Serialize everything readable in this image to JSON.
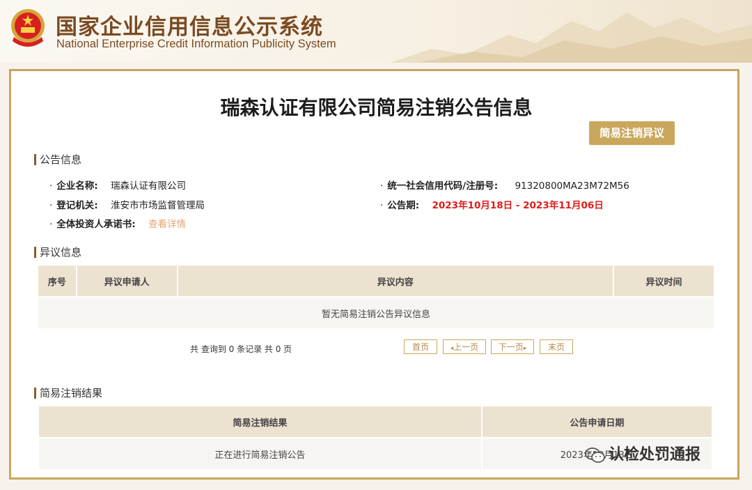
{
  "site": {
    "title": "国家企业信用信息公示系统",
    "subtitle": "National Enterprise Credit Information Publicity System"
  },
  "notice": {
    "title": "瑞森认证有限公司简易注销公告信息",
    "objection_button": "简易注销异议"
  },
  "announcement": {
    "section_title": "公告信息",
    "company_name_label": "企业名称:",
    "company_name": "瑞森认证有限公司",
    "credit_code_label": "统一社会信用代码/注册号:",
    "credit_code": "91320800MA23M72M56",
    "authority_label": "登记机关:",
    "authority": "淮安市市场监督管理局",
    "period_label": "公告期:",
    "period": "2023年10月18日 - 2023年11月06日",
    "commitment_label": "全体投资人承诺书:",
    "commitment_link": "查看详情"
  },
  "objections": {
    "section_title": "异议信息",
    "columns": [
      "序号",
      "异议申请人",
      "异议内容",
      "异议时间"
    ],
    "empty_text": "暂无简易注销公告异议信息",
    "count_text": "共 查询到 0 条记录 共 0 页",
    "pager": {
      "first": "首页",
      "prev": "上一页",
      "next": "下一页",
      "last": "末页"
    }
  },
  "result": {
    "section_title": "简易注销结果",
    "columns": [
      "简易注销结果",
      "公告申请日期"
    ],
    "rows": [
      {
        "result": "正在进行简易注销公告",
        "date": "2023年10月13日"
      }
    ]
  },
  "watermark": "认检处罚通报",
  "colors": {
    "brand_gold": "#c9a75d",
    "title_brown": "#7a4a22",
    "highlight_red": "#e01b1b",
    "link_orange": "#e8a66e"
  }
}
